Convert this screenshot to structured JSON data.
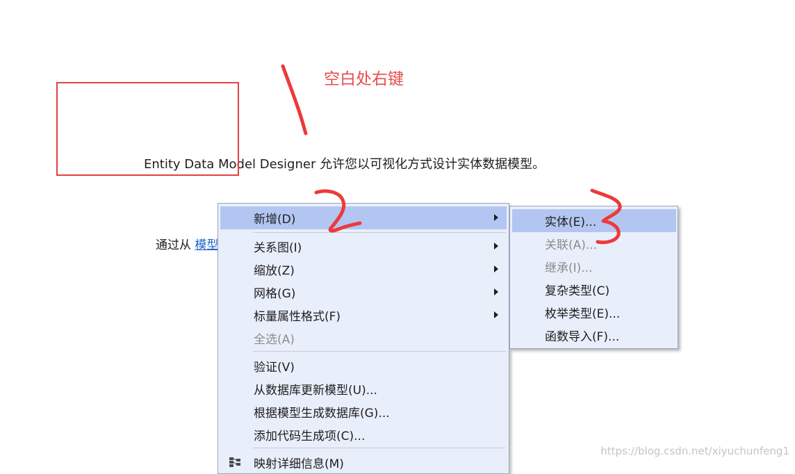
{
  "canvas": {
    "description": "Entity Data Model Designer 允许您以可视化方式设计实体数据模型。",
    "hint_prefix": "通过从",
    "hint_link": "模型"
  },
  "annotation": {
    "label": "空白处右键",
    "color": "#e84c4c"
  },
  "context_menu": {
    "items": [
      {
        "label": "新增(D)",
        "has_submenu": true,
        "highlighted": true
      },
      {
        "label": "关系图(I)",
        "has_submenu": true
      },
      {
        "label": "缩放(Z)",
        "has_submenu": true
      },
      {
        "label": "网格(G)",
        "has_submenu": true
      },
      {
        "label": "标量属性格式(F)",
        "has_submenu": true
      },
      {
        "label": "全选(A)",
        "disabled": true
      },
      {
        "label": "验证(V)"
      },
      {
        "label": "从数据库更新模型(U)..."
      },
      {
        "label": "根据模型生成数据库(G)..."
      },
      {
        "label": "添加代码生成项(C)..."
      },
      {
        "label": "映射详细信息(M)",
        "icon": "mapping-details-icon"
      }
    ]
  },
  "submenu": {
    "items": [
      {
        "label": "实体(E)...",
        "highlighted": true
      },
      {
        "label": "关联(A)...",
        "disabled": true
      },
      {
        "label": "继承(I)...",
        "disabled": true
      },
      {
        "label": "复杂类型(C)"
      },
      {
        "label": "枚举类型(E)..."
      },
      {
        "label": "函数导入(F)..."
      }
    ]
  },
  "watermark": "https://blog.csdn.net/xiyuchunfeng1",
  "colors": {
    "menu_background": "#e9eefb",
    "menu_highlight": "#b3c6f2",
    "annotation_red": "#e84c4c",
    "link_blue": "#1a64c8"
  }
}
